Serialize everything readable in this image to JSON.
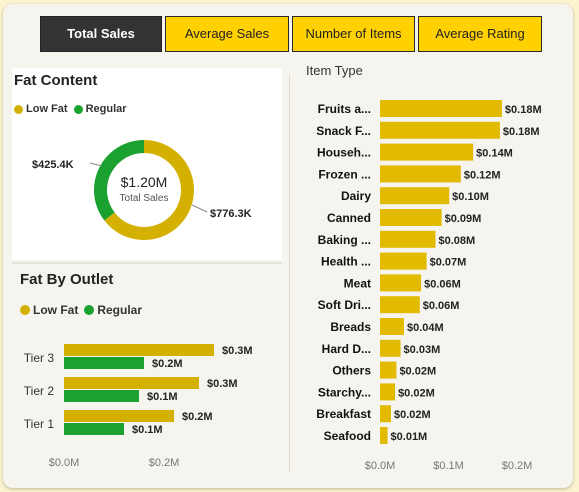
{
  "tabs": [
    {
      "label": "Total Sales",
      "active": true
    },
    {
      "label": "Average Sales",
      "active": false
    },
    {
      "label": "Number of Items",
      "active": false
    },
    {
      "label": "Average Rating",
      "active": false
    }
  ],
  "colors": {
    "low_fat": "#d4b000",
    "regular": "#1aa130",
    "item_bar": "#e2ba00",
    "tab_active": "#333333",
    "tab_inactive": "#ffd100"
  },
  "fat_content": {
    "title": "Fat Content",
    "legend": [
      "Low Fat",
      "Regular"
    ],
    "center_value": "$1.20M",
    "center_label": "Total Sales",
    "low_fat_label": "$776.3K",
    "regular_label": "$425.4K"
  },
  "fat_by_outlet": {
    "title": "Fat By Outlet",
    "legend": [
      "Low Fat",
      "Regular"
    ]
  },
  "item_type": {
    "title": "Item Type"
  },
  "chart_data": [
    {
      "type": "pie",
      "title": "Fat Content",
      "categories": [
        "Low Fat",
        "Regular"
      ],
      "values": [
        776.3,
        425.4
      ],
      "unit": "K",
      "data_labels": [
        "$776.3K",
        "$425.4K"
      ],
      "legend": "top-left",
      "center_text": [
        "$1.20M",
        "Total Sales"
      ]
    },
    {
      "type": "bar",
      "orientation": "horizontal",
      "title": "Fat By Outlet",
      "categories": [
        "Tier 3",
        "Tier 2",
        "Tier 1"
      ],
      "series": [
        {
          "name": "Low Fat",
          "values": [
            0.3,
            0.27,
            0.22
          ],
          "labels": [
            "$0.3M",
            "$0.3M",
            "$0.2M"
          ]
        },
        {
          "name": "Regular",
          "values": [
            0.16,
            0.15,
            0.12
          ],
          "labels": [
            "$0.2M",
            "$0.1M",
            "$0.1M"
          ]
        }
      ],
      "xlim": [
        0,
        0.4
      ],
      "xticks": [
        "$0.0M",
        "$0.2M"
      ],
      "xtick_values": [
        0,
        0.2
      ],
      "legend": "top-left",
      "grid": false
    },
    {
      "type": "bar",
      "orientation": "horizontal",
      "title": "Item Type",
      "categories": [
        "Fruits a...",
        "Snack F...",
        "Househ...",
        "Frozen ...",
        "Dairy",
        "Canned",
        "Baking ...",
        "Health ...",
        "Meat",
        "Soft Dri...",
        "Breads",
        "Hard D...",
        "Others",
        "Starchy...",
        "Breakfast",
        "Seafood"
      ],
      "values": [
        0.178,
        0.175,
        0.136,
        0.118,
        0.101,
        0.09,
        0.081,
        0.068,
        0.06,
        0.058,
        0.035,
        0.03,
        0.024,
        0.022,
        0.016,
        0.011
      ],
      "labels": [
        "$0.18M",
        "$0.18M",
        "$0.14M",
        "$0.12M",
        "$0.10M",
        "$0.09M",
        "$0.08M",
        "$0.07M",
        "$0.06M",
        "$0.06M",
        "$0.04M",
        "$0.03M",
        "$0.02M",
        "$0.02M",
        "$0.02M",
        "$0.01M"
      ],
      "xlim": [
        0,
        0.2
      ],
      "xticks": [
        "$0.0M",
        "$0.1M",
        "$0.2M"
      ],
      "xtick_values": [
        0,
        0.1,
        0.2
      ],
      "grid": false
    }
  ]
}
